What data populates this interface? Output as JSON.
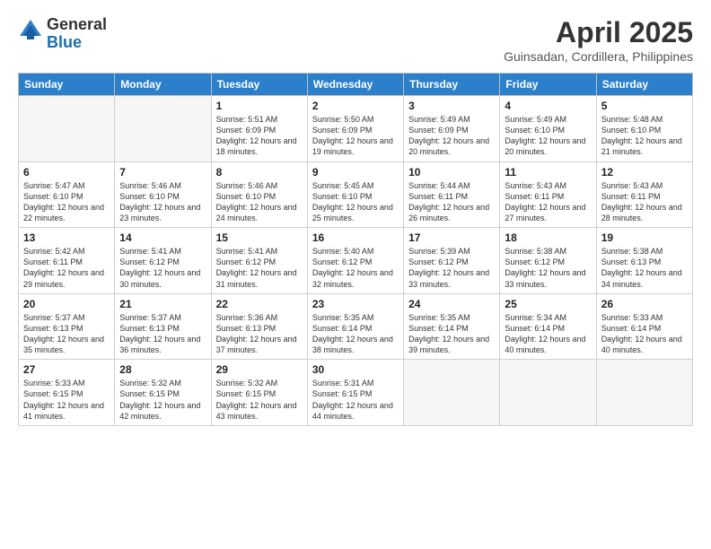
{
  "logo": {
    "general": "General",
    "blue": "Blue"
  },
  "title": "April 2025",
  "subtitle": "Guinsadan, Cordillera, Philippines",
  "days_of_week": [
    "Sunday",
    "Monday",
    "Tuesday",
    "Wednesday",
    "Thursday",
    "Friday",
    "Saturday"
  ],
  "weeks": [
    [
      {
        "day": "",
        "sunrise": "",
        "sunset": "",
        "daylight": ""
      },
      {
        "day": "",
        "sunrise": "",
        "sunset": "",
        "daylight": ""
      },
      {
        "day": "1",
        "sunrise": "Sunrise: 5:51 AM",
        "sunset": "Sunset: 6:09 PM",
        "daylight": "Daylight: 12 hours and 18 minutes."
      },
      {
        "day": "2",
        "sunrise": "Sunrise: 5:50 AM",
        "sunset": "Sunset: 6:09 PM",
        "daylight": "Daylight: 12 hours and 19 minutes."
      },
      {
        "day": "3",
        "sunrise": "Sunrise: 5:49 AM",
        "sunset": "Sunset: 6:09 PM",
        "daylight": "Daylight: 12 hours and 20 minutes."
      },
      {
        "day": "4",
        "sunrise": "Sunrise: 5:49 AM",
        "sunset": "Sunset: 6:10 PM",
        "daylight": "Daylight: 12 hours and 20 minutes."
      },
      {
        "day": "5",
        "sunrise": "Sunrise: 5:48 AM",
        "sunset": "Sunset: 6:10 PM",
        "daylight": "Daylight: 12 hours and 21 minutes."
      }
    ],
    [
      {
        "day": "6",
        "sunrise": "Sunrise: 5:47 AM",
        "sunset": "Sunset: 6:10 PM",
        "daylight": "Daylight: 12 hours and 22 minutes."
      },
      {
        "day": "7",
        "sunrise": "Sunrise: 5:46 AM",
        "sunset": "Sunset: 6:10 PM",
        "daylight": "Daylight: 12 hours and 23 minutes."
      },
      {
        "day": "8",
        "sunrise": "Sunrise: 5:46 AM",
        "sunset": "Sunset: 6:10 PM",
        "daylight": "Daylight: 12 hours and 24 minutes."
      },
      {
        "day": "9",
        "sunrise": "Sunrise: 5:45 AM",
        "sunset": "Sunset: 6:10 PM",
        "daylight": "Daylight: 12 hours and 25 minutes."
      },
      {
        "day": "10",
        "sunrise": "Sunrise: 5:44 AM",
        "sunset": "Sunset: 6:11 PM",
        "daylight": "Daylight: 12 hours and 26 minutes."
      },
      {
        "day": "11",
        "sunrise": "Sunrise: 5:43 AM",
        "sunset": "Sunset: 6:11 PM",
        "daylight": "Daylight: 12 hours and 27 minutes."
      },
      {
        "day": "12",
        "sunrise": "Sunrise: 5:43 AM",
        "sunset": "Sunset: 6:11 PM",
        "daylight": "Daylight: 12 hours and 28 minutes."
      }
    ],
    [
      {
        "day": "13",
        "sunrise": "Sunrise: 5:42 AM",
        "sunset": "Sunset: 6:11 PM",
        "daylight": "Daylight: 12 hours and 29 minutes."
      },
      {
        "day": "14",
        "sunrise": "Sunrise: 5:41 AM",
        "sunset": "Sunset: 6:12 PM",
        "daylight": "Daylight: 12 hours and 30 minutes."
      },
      {
        "day": "15",
        "sunrise": "Sunrise: 5:41 AM",
        "sunset": "Sunset: 6:12 PM",
        "daylight": "Daylight: 12 hours and 31 minutes."
      },
      {
        "day": "16",
        "sunrise": "Sunrise: 5:40 AM",
        "sunset": "Sunset: 6:12 PM",
        "daylight": "Daylight: 12 hours and 32 minutes."
      },
      {
        "day": "17",
        "sunrise": "Sunrise: 5:39 AM",
        "sunset": "Sunset: 6:12 PM",
        "daylight": "Daylight: 12 hours and 33 minutes."
      },
      {
        "day": "18",
        "sunrise": "Sunrise: 5:38 AM",
        "sunset": "Sunset: 6:12 PM",
        "daylight": "Daylight: 12 hours and 33 minutes."
      },
      {
        "day": "19",
        "sunrise": "Sunrise: 5:38 AM",
        "sunset": "Sunset: 6:13 PM",
        "daylight": "Daylight: 12 hours and 34 minutes."
      }
    ],
    [
      {
        "day": "20",
        "sunrise": "Sunrise: 5:37 AM",
        "sunset": "Sunset: 6:13 PM",
        "daylight": "Daylight: 12 hours and 35 minutes."
      },
      {
        "day": "21",
        "sunrise": "Sunrise: 5:37 AM",
        "sunset": "Sunset: 6:13 PM",
        "daylight": "Daylight: 12 hours and 36 minutes."
      },
      {
        "day": "22",
        "sunrise": "Sunrise: 5:36 AM",
        "sunset": "Sunset: 6:13 PM",
        "daylight": "Daylight: 12 hours and 37 minutes."
      },
      {
        "day": "23",
        "sunrise": "Sunrise: 5:35 AM",
        "sunset": "Sunset: 6:14 PM",
        "daylight": "Daylight: 12 hours and 38 minutes."
      },
      {
        "day": "24",
        "sunrise": "Sunrise: 5:35 AM",
        "sunset": "Sunset: 6:14 PM",
        "daylight": "Daylight: 12 hours and 39 minutes."
      },
      {
        "day": "25",
        "sunrise": "Sunrise: 5:34 AM",
        "sunset": "Sunset: 6:14 PM",
        "daylight": "Daylight: 12 hours and 40 minutes."
      },
      {
        "day": "26",
        "sunrise": "Sunrise: 5:33 AM",
        "sunset": "Sunset: 6:14 PM",
        "daylight": "Daylight: 12 hours and 40 minutes."
      }
    ],
    [
      {
        "day": "27",
        "sunrise": "Sunrise: 5:33 AM",
        "sunset": "Sunset: 6:15 PM",
        "daylight": "Daylight: 12 hours and 41 minutes."
      },
      {
        "day": "28",
        "sunrise": "Sunrise: 5:32 AM",
        "sunset": "Sunset: 6:15 PM",
        "daylight": "Daylight: 12 hours and 42 minutes."
      },
      {
        "day": "29",
        "sunrise": "Sunrise: 5:32 AM",
        "sunset": "Sunset: 6:15 PM",
        "daylight": "Daylight: 12 hours and 43 minutes."
      },
      {
        "day": "30",
        "sunrise": "Sunrise: 5:31 AM",
        "sunset": "Sunset: 6:15 PM",
        "daylight": "Daylight: 12 hours and 44 minutes."
      },
      {
        "day": "",
        "sunrise": "",
        "sunset": "",
        "daylight": ""
      },
      {
        "day": "",
        "sunrise": "",
        "sunset": "",
        "daylight": ""
      },
      {
        "day": "",
        "sunrise": "",
        "sunset": "",
        "daylight": ""
      }
    ]
  ]
}
